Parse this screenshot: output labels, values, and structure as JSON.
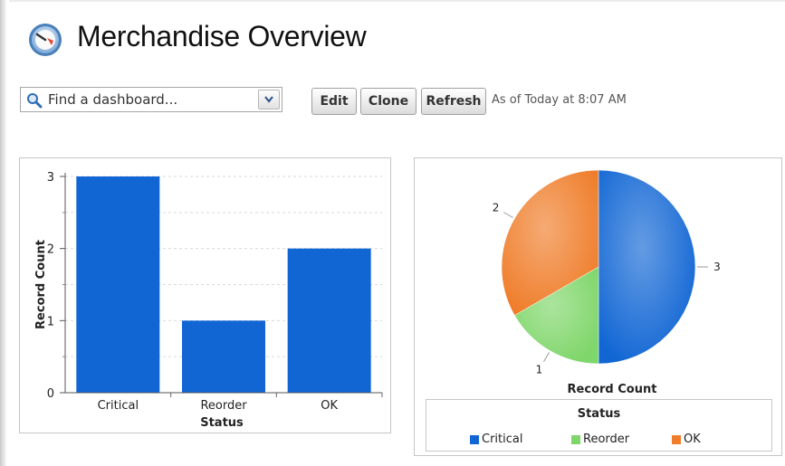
{
  "header": {
    "title": "Merchandise Overview",
    "icon": "dashboard-gauge-icon"
  },
  "toolbar": {
    "search_placeholder": "Find a dashboard...",
    "edit_label": "Edit",
    "clone_label": "Clone",
    "refresh_label": "Refresh",
    "as_of": "As of Today at 8:07 AM"
  },
  "colors": {
    "critical": "#1166d4",
    "reorder": "#7fd66a",
    "ok": "#ef7d2a"
  },
  "chart_data": [
    {
      "type": "bar",
      "categories": [
        "Critical",
        "Reorder",
        "OK"
      ],
      "values": [
        3,
        1,
        2
      ],
      "xlabel": "Status",
      "ylabel": "Record Count",
      "ylim": [
        0,
        3
      ],
      "yticks": [
        "0",
        "1",
        "2",
        "3"
      ],
      "grid": true
    },
    {
      "type": "pie",
      "labels": [
        "Critical",
        "Reorder",
        "OK"
      ],
      "values": [
        3,
        1,
        2
      ],
      "value_labels": [
        "3",
        "1",
        "2"
      ],
      "caption": "Record Count",
      "legend_title": "Status",
      "legend_position": "bottom"
    }
  ]
}
